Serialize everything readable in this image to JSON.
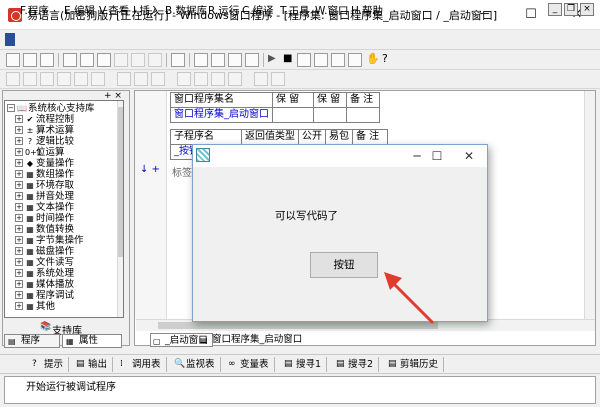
{
  "window": {
    "title": "易语言(加密狗版) [正在运行] - Windows窗口程序 - [程序集: 窗口程序集_启动窗口 / _启动窗口]",
    "controls": {
      "minimize": "─",
      "maximize": "☐",
      "close": "✕"
    }
  },
  "menu": {
    "items": [
      {
        "label": "F.程序"
      },
      {
        "label": "E.编辑"
      },
      {
        "label": "V.查看"
      },
      {
        "label": "I.插入"
      },
      {
        "label": "B.数据库"
      },
      {
        "label": "R.运行"
      },
      {
        "label": "C.编译"
      },
      {
        "label": "T.工具"
      },
      {
        "label": "W.窗口"
      },
      {
        "label": "H.帮助"
      }
    ],
    "mdi_controls": [
      "_",
      "❐",
      "×"
    ]
  },
  "left_panel": {
    "header_buttons": "+ ×",
    "tree": [
      {
        "label": "系统核心支持库",
        "expander": "−",
        "icon": "📖"
      },
      {
        "label": "流程控制",
        "expander": "+",
        "icon": "✔"
      },
      {
        "label": "算术运算",
        "expander": "+",
        "icon": "±"
      },
      {
        "label": "逻辑比较",
        "expander": "+",
        "icon": "?"
      },
      {
        "label": "位运算",
        "expander": "+",
        "icon": "0+1"
      },
      {
        "label": "变量操作",
        "expander": "+",
        "icon": "◆"
      },
      {
        "label": "数组操作",
        "expander": "+",
        "icon": "▦"
      },
      {
        "label": "环境存取",
        "expander": "+",
        "icon": "▦"
      },
      {
        "label": "拼音处理",
        "expander": "+",
        "icon": "▦"
      },
      {
        "label": "文本操作",
        "expander": "+",
        "icon": "▦"
      },
      {
        "label": "时间操作",
        "expander": "+",
        "icon": "▦"
      },
      {
        "label": "数值转换",
        "expander": "+",
        "icon": "▦"
      },
      {
        "label": "字节集操作",
        "expander": "+",
        "icon": "▦"
      },
      {
        "label": "磁盘操作",
        "expander": "+",
        "icon": "▦"
      },
      {
        "label": "文件读写",
        "expander": "+",
        "icon": "▦"
      },
      {
        "label": "系统处理",
        "expander": "+",
        "icon": "▦"
      },
      {
        "label": "媒体播放",
        "expander": "+",
        "icon": "▦"
      },
      {
        "label": "程序调试",
        "expander": "+",
        "icon": "▦"
      },
      {
        "label": "其他",
        "expander": "+",
        "icon": "▦"
      }
    ],
    "library_label": "支持库",
    "tabs": [
      {
        "label": "程序"
      },
      {
        "label": "属性"
      }
    ]
  },
  "editor": {
    "assembly_table": {
      "headers": [
        "窗口程序集名",
        "保 留",
        "保 留",
        "备 注"
      ],
      "row": [
        "窗口程序集_启动窗口",
        "",
        "",
        ""
      ]
    },
    "sub_table": {
      "headers": [
        "子程序名",
        "返回值类型",
        "公开",
        "易包",
        "备 注"
      ],
      "row": [
        "_按钮",
        "",
        "",
        "",
        ""
      ]
    },
    "code_line": "标签",
    "marker": "↓ +",
    "tabs": [
      {
        "label": "_启动窗口"
      },
      {
        "label": "窗口程序集_启动窗口"
      }
    ]
  },
  "dialog": {
    "controls": {
      "minimize": "─",
      "maximize": "☐",
      "close": "✕"
    },
    "label": "可以写代码了",
    "button": "按钮"
  },
  "bottom_tabs": [
    {
      "label": "提示",
      "icon": "?"
    },
    {
      "label": "输出",
      "icon": "▤"
    },
    {
      "label": "调用表",
      "icon": "⁞"
    },
    {
      "label": "监视表",
      "icon": "🔍"
    },
    {
      "label": "变量表",
      "icon": "∞"
    },
    {
      "label": "搜寻1",
      "icon": "▤"
    },
    {
      "label": "搜寻2",
      "icon": "▤"
    },
    {
      "label": "剪辑历史",
      "icon": "▤"
    }
  ],
  "output": {
    "text": "开始运行被调试程序"
  },
  "colors": {
    "accent_blue": "#0000c8",
    "arrow_red": "#e23a2c",
    "dialog_border": "#7da2ce"
  }
}
